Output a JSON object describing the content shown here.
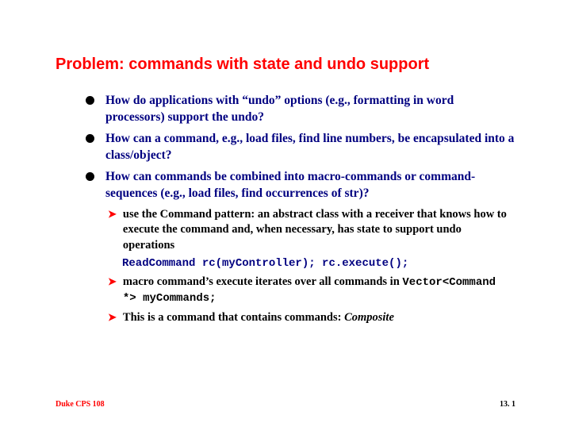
{
  "title": "Problem: commands with state and undo support",
  "bullets": [
    "How do applications with “undo” options (e.g., formatting in word processors) support the undo?",
    "How can a command, e.g., load files, find line numbers, be encapsulated into a class/object?",
    "How can commands be combined into macro-commands or command-sequences (e.g., load files, find occurrences of str)?"
  ],
  "sub1": "use the Command pattern: an abstract class with a receiver that knows how to execute the command and, when necessary, has state to support undo operations",
  "code1": "ReadCommand rc(myController);  rc.execute();",
  "sub2": "macro command’s execute iterates over all commands in",
  "code2": "Vector<Command *> myCommands;",
  "sub3_a": "This is a command that contains commands: ",
  "sub3_b": "Composite",
  "footer_left": "Duke CPS 108",
  "footer_right": "13. 1"
}
